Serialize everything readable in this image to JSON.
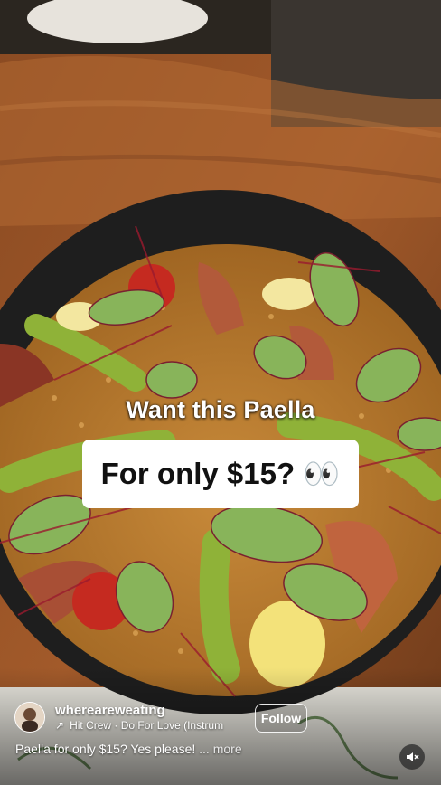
{
  "overlay": {
    "caption_top": "Want this Paella",
    "caption_box": "For only $15? 👀"
  },
  "account": {
    "username": "whereareweating",
    "follow_label": "Follow"
  },
  "audio": {
    "track": "Hit Crew · Do For Love (Instrum"
  },
  "post": {
    "description": "Paella for only $15? Yes please!",
    "ellipsis": "...",
    "more_label": "more"
  },
  "icons": {
    "audio": "arrow-up-right-icon",
    "mute": "speaker-muted-icon"
  }
}
